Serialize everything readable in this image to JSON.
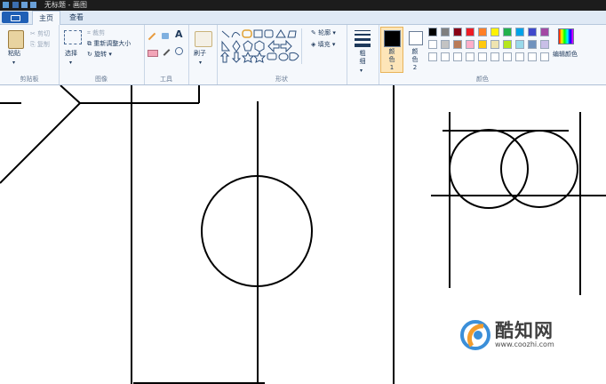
{
  "window": {
    "title": "无标题 - 画图"
  },
  "tabs": [
    {
      "label": "主页"
    },
    {
      "label": "查看"
    }
  ],
  "clipboard": {
    "paste": "粘贴",
    "cut": "剪切",
    "copy": "复制",
    "group": "剪贴板"
  },
  "image": {
    "select": "选择",
    "crop": "裁剪",
    "resize": "重新调整大小",
    "rotate": "旋转",
    "group": "图像"
  },
  "tools": {
    "group": "工具",
    "text_tool": "A"
  },
  "brushes": {
    "label": "刷子"
  },
  "shapes": {
    "outline": "轮廓",
    "fill": "填充",
    "group": "形状"
  },
  "size": {
    "label": "粗细"
  },
  "colors": {
    "color1": "颜色 1",
    "color2": "颜色 2",
    "edit": "编辑颜色",
    "group": "颜色",
    "color1_value": "#000000",
    "color2_value": "#ffffff",
    "palette_row1": [
      "#000000",
      "#7f7f7f",
      "#880015",
      "#ed1c24",
      "#ff7f27",
      "#fff200",
      "#22b14c",
      "#00a2e8",
      "#3f48cc",
      "#a349a4"
    ],
    "palette_row2": [
      "#ffffff",
      "#c3c3c3",
      "#b97a57",
      "#ffaec9",
      "#ffc90e",
      "#efe4b0",
      "#b5e61d",
      "#99d9ea",
      "#7092be",
      "#c8bfe7"
    ],
    "palette_row3": [
      "#ffffff",
      "#ffffff",
      "#ffffff",
      "#ffffff",
      "#ffffff",
      "#ffffff",
      "#ffffff",
      "#ffffff",
      "#ffffff",
      "#ffffff"
    ]
  },
  "watermark": {
    "name": "酷知网",
    "url": "www.coozhi.com"
  }
}
